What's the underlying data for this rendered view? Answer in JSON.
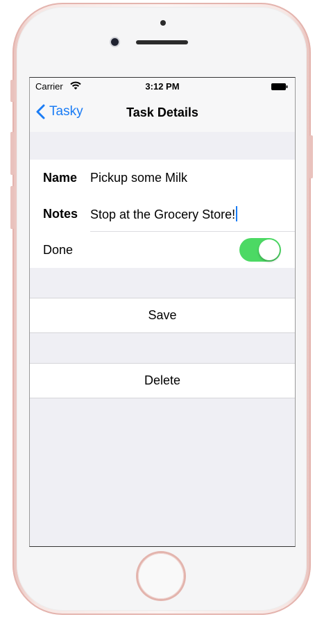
{
  "status_bar": {
    "carrier": "Carrier",
    "time": "3:12 PM"
  },
  "nav": {
    "back_label": "Tasky",
    "title": "Task Details"
  },
  "form": {
    "name_label": "Name",
    "name_value": "Pickup some Milk",
    "notes_label": "Notes",
    "notes_value": "Stop at the Grocery Store!",
    "done_label": "Done",
    "done_on": true
  },
  "actions": {
    "save_label": "Save",
    "delete_label": "Delete"
  },
  "colors": {
    "accent": "#1a7cf5",
    "toggle_on": "#4cd964",
    "grouped_background": "#efeff4",
    "phone_body": "#f7e6e3"
  },
  "icons": [
    "wifi-icon",
    "battery-icon",
    "chevron-left-icon"
  ]
}
